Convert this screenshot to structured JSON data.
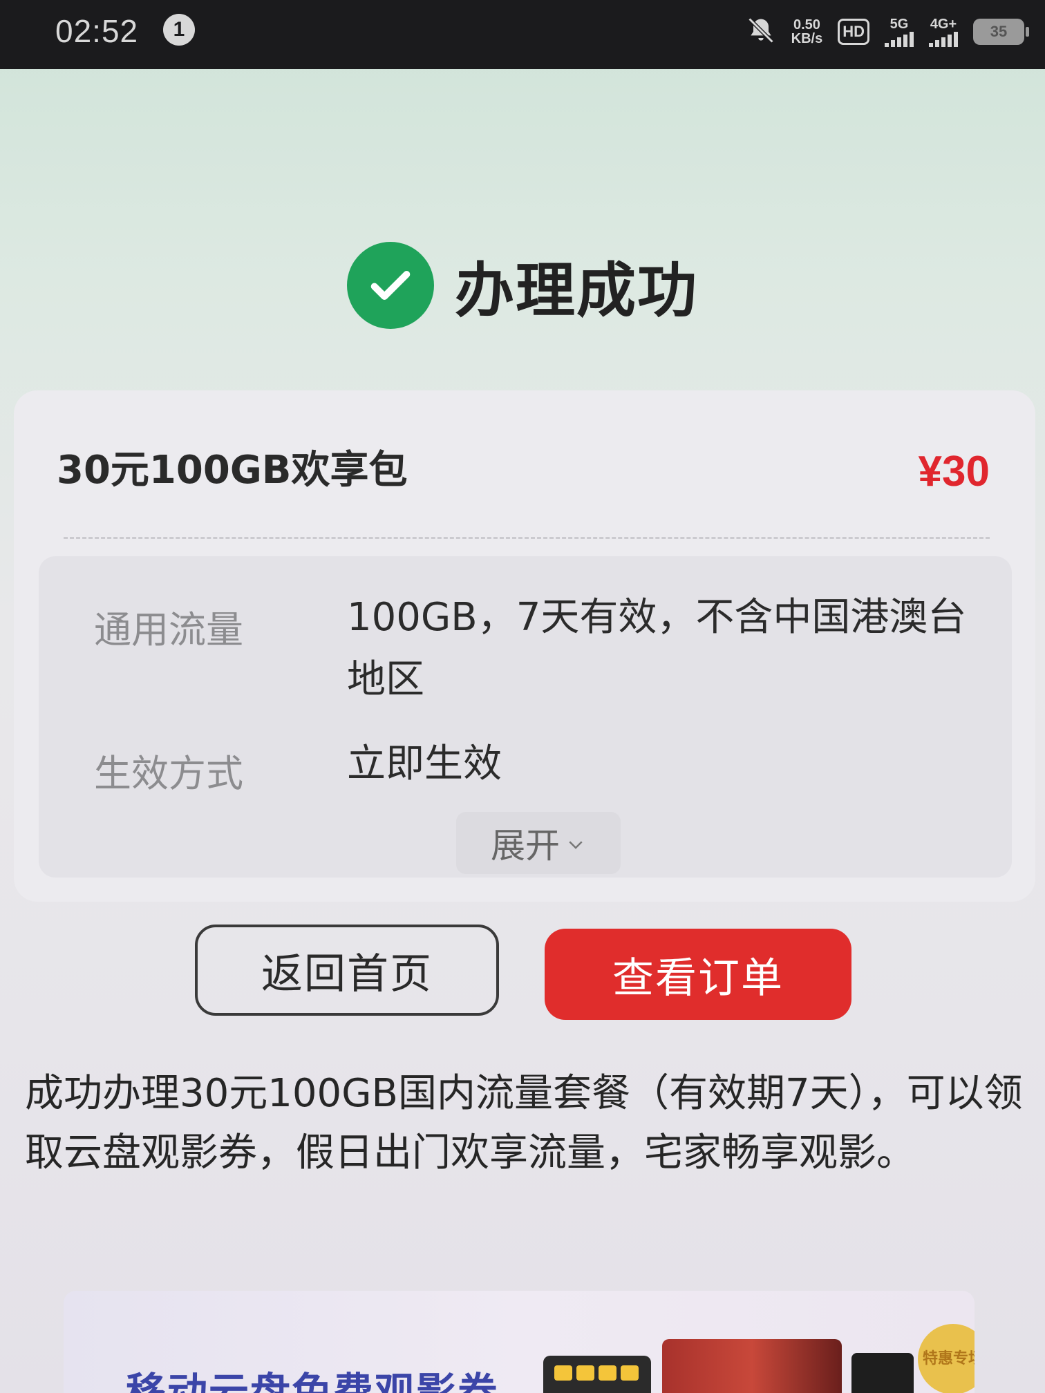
{
  "status_bar": {
    "time": "02:52",
    "notification_count": "1",
    "net_speed_value": "0.50",
    "net_speed_unit": "KB/s",
    "hd_label": "HD",
    "sig1_label": "5G",
    "sig2_label": "4G+",
    "battery": "35",
    "icons": [
      "bell-muted-icon",
      "hd-icon",
      "signal-icon",
      "signal-icon",
      "battery-icon"
    ]
  },
  "success": {
    "title": "办理成功",
    "icon": "check-circle-icon",
    "icon_color": "#1fa35a"
  },
  "product": {
    "name": "30元100GB欢享包",
    "price": "¥30",
    "price_color": "#e0262e",
    "details": [
      {
        "label": "通用流量",
        "value": "100GB，7天有效，不含中国港澳台地区"
      },
      {
        "label": "生效方式",
        "value": "立即生效"
      }
    ],
    "expand_label": "展开"
  },
  "actions": {
    "home_label": "返回首页",
    "order_label": "查看订单",
    "order_color": "#e02d2c"
  },
  "description": "成功办理30元100GB国内流量套餐（有效期7天），可以领取云盘观影券，假日出门欢享流量，宅家畅享观影。",
  "banner": {
    "title": "移动云盘免费观影券",
    "seal_text": "特惠专场"
  }
}
